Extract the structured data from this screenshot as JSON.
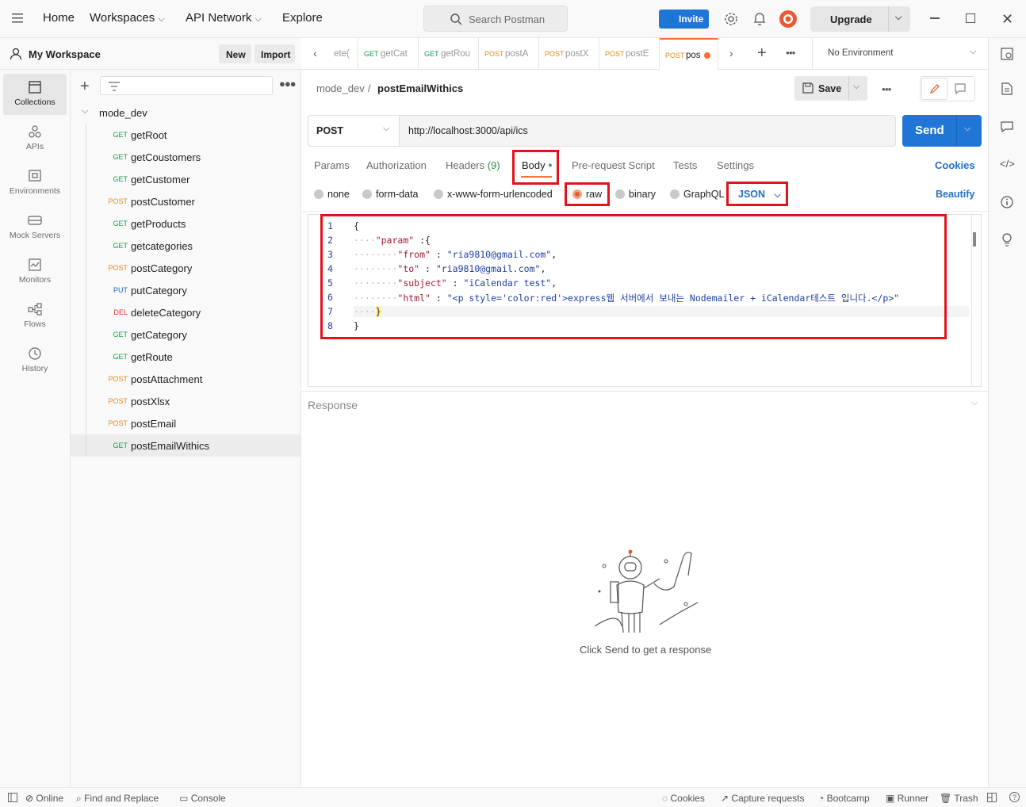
{
  "topbar": {
    "nav": [
      "Home",
      "Workspaces",
      "API Network",
      "Explore"
    ],
    "search_placeholder": "Search Postman",
    "invite": "Invite",
    "upgrade": "Upgrade"
  },
  "workspace": {
    "name": "My Workspace",
    "new": "New",
    "import": "Import"
  },
  "rail": [
    "Collections",
    "APIs",
    "Environments",
    "Mock Servers",
    "Monitors",
    "Flows",
    "History"
  ],
  "collection": {
    "name": "mode_dev",
    "items": [
      {
        "method": "GET",
        "name": "getRoot"
      },
      {
        "method": "GET",
        "name": "getCoustomers"
      },
      {
        "method": "GET",
        "name": "getCustomer"
      },
      {
        "method": "POST",
        "name": "postCustomer"
      },
      {
        "method": "GET",
        "name": "getProducts"
      },
      {
        "method": "GET",
        "name": "getcategories"
      },
      {
        "method": "POST",
        "name": "postCategory"
      },
      {
        "method": "PUT",
        "name": "putCategory"
      },
      {
        "method": "DEL",
        "name": "deleteCategory"
      },
      {
        "method": "GET",
        "name": "getCategory"
      },
      {
        "method": "GET",
        "name": "getRoute"
      },
      {
        "method": "POST",
        "name": "postAttachment"
      },
      {
        "method": "POST",
        "name": "postXlsx"
      },
      {
        "method": "POST",
        "name": "postEmail"
      },
      {
        "method": "GET",
        "name": "postEmailWithics"
      }
    ]
  },
  "tabs": [
    {
      "method": "",
      "name": "ete("
    },
    {
      "method": "GET",
      "name": "getCat"
    },
    {
      "method": "GET",
      "name": "getRou"
    },
    {
      "method": "POST",
      "name": "postA"
    },
    {
      "method": "POST",
      "name": "postX"
    },
    {
      "method": "POST",
      "name": "postE"
    },
    {
      "method": "POST",
      "name": "pos"
    }
  ],
  "environment": "No Environment",
  "breadcrumb": {
    "parent": "mode_dev",
    "separator": "/",
    "current": "postEmailWithics"
  },
  "save": "Save",
  "request": {
    "method": "POST",
    "url": "http://localhost:3000/api/ics",
    "send": "Send"
  },
  "subtabs": {
    "params": "Params",
    "authorization": "Authorization",
    "headers": "Headers",
    "headers_count": "(9)",
    "body": "Body",
    "prerequest": "Pre-request Script",
    "tests": "Tests",
    "settings": "Settings",
    "cookies": "Cookies"
  },
  "body_types": {
    "none": "none",
    "formdata": "form-data",
    "urlencoded": "x-www-form-urlencoded",
    "raw": "raw",
    "binary": "binary",
    "graphql": "GraphQL",
    "format": "JSON",
    "beautify": "Beautify"
  },
  "editor_line_numbers": [
    "1",
    "2",
    "3",
    "4",
    "5",
    "6",
    "7",
    "8"
  ],
  "code": {
    "l1": "{",
    "l2_key": "\"param\"",
    "l2_rest": " :{",
    "l3_key": "\"from\"",
    "l3_val": "\"ria9810@gmail.com\"",
    "l4_key": "\"to\"",
    "l4_val": "\"ria9810@gmail.com\"",
    "l5_key": "\"subject\"",
    "l5_val": "\"iCalendar test\"",
    "l6_key": "\"html\"",
    "l6_val": "\"<p style='color:red'>express웹 서버에서 보내는 Nodemailer + iCalendar테스트 입니다.</p>\"",
    "l7": "}",
    "l8": "}"
  },
  "response": {
    "label": "Response",
    "hint": "Click Send to get a response"
  },
  "statusbar": {
    "online": "Online",
    "find": "Find and Replace",
    "console": "Console",
    "cookies": "Cookies",
    "capture": "Capture requests",
    "bootcamp": "Bootcamp",
    "runner": "Runner",
    "trash": "Trash"
  },
  "colors": {
    "get": "#14a04a",
    "post": "#e78a1a",
    "put": "#2166c4",
    "del": "#d33a2c",
    "accent": "#ff6c37",
    "send": "#1f76d6"
  }
}
